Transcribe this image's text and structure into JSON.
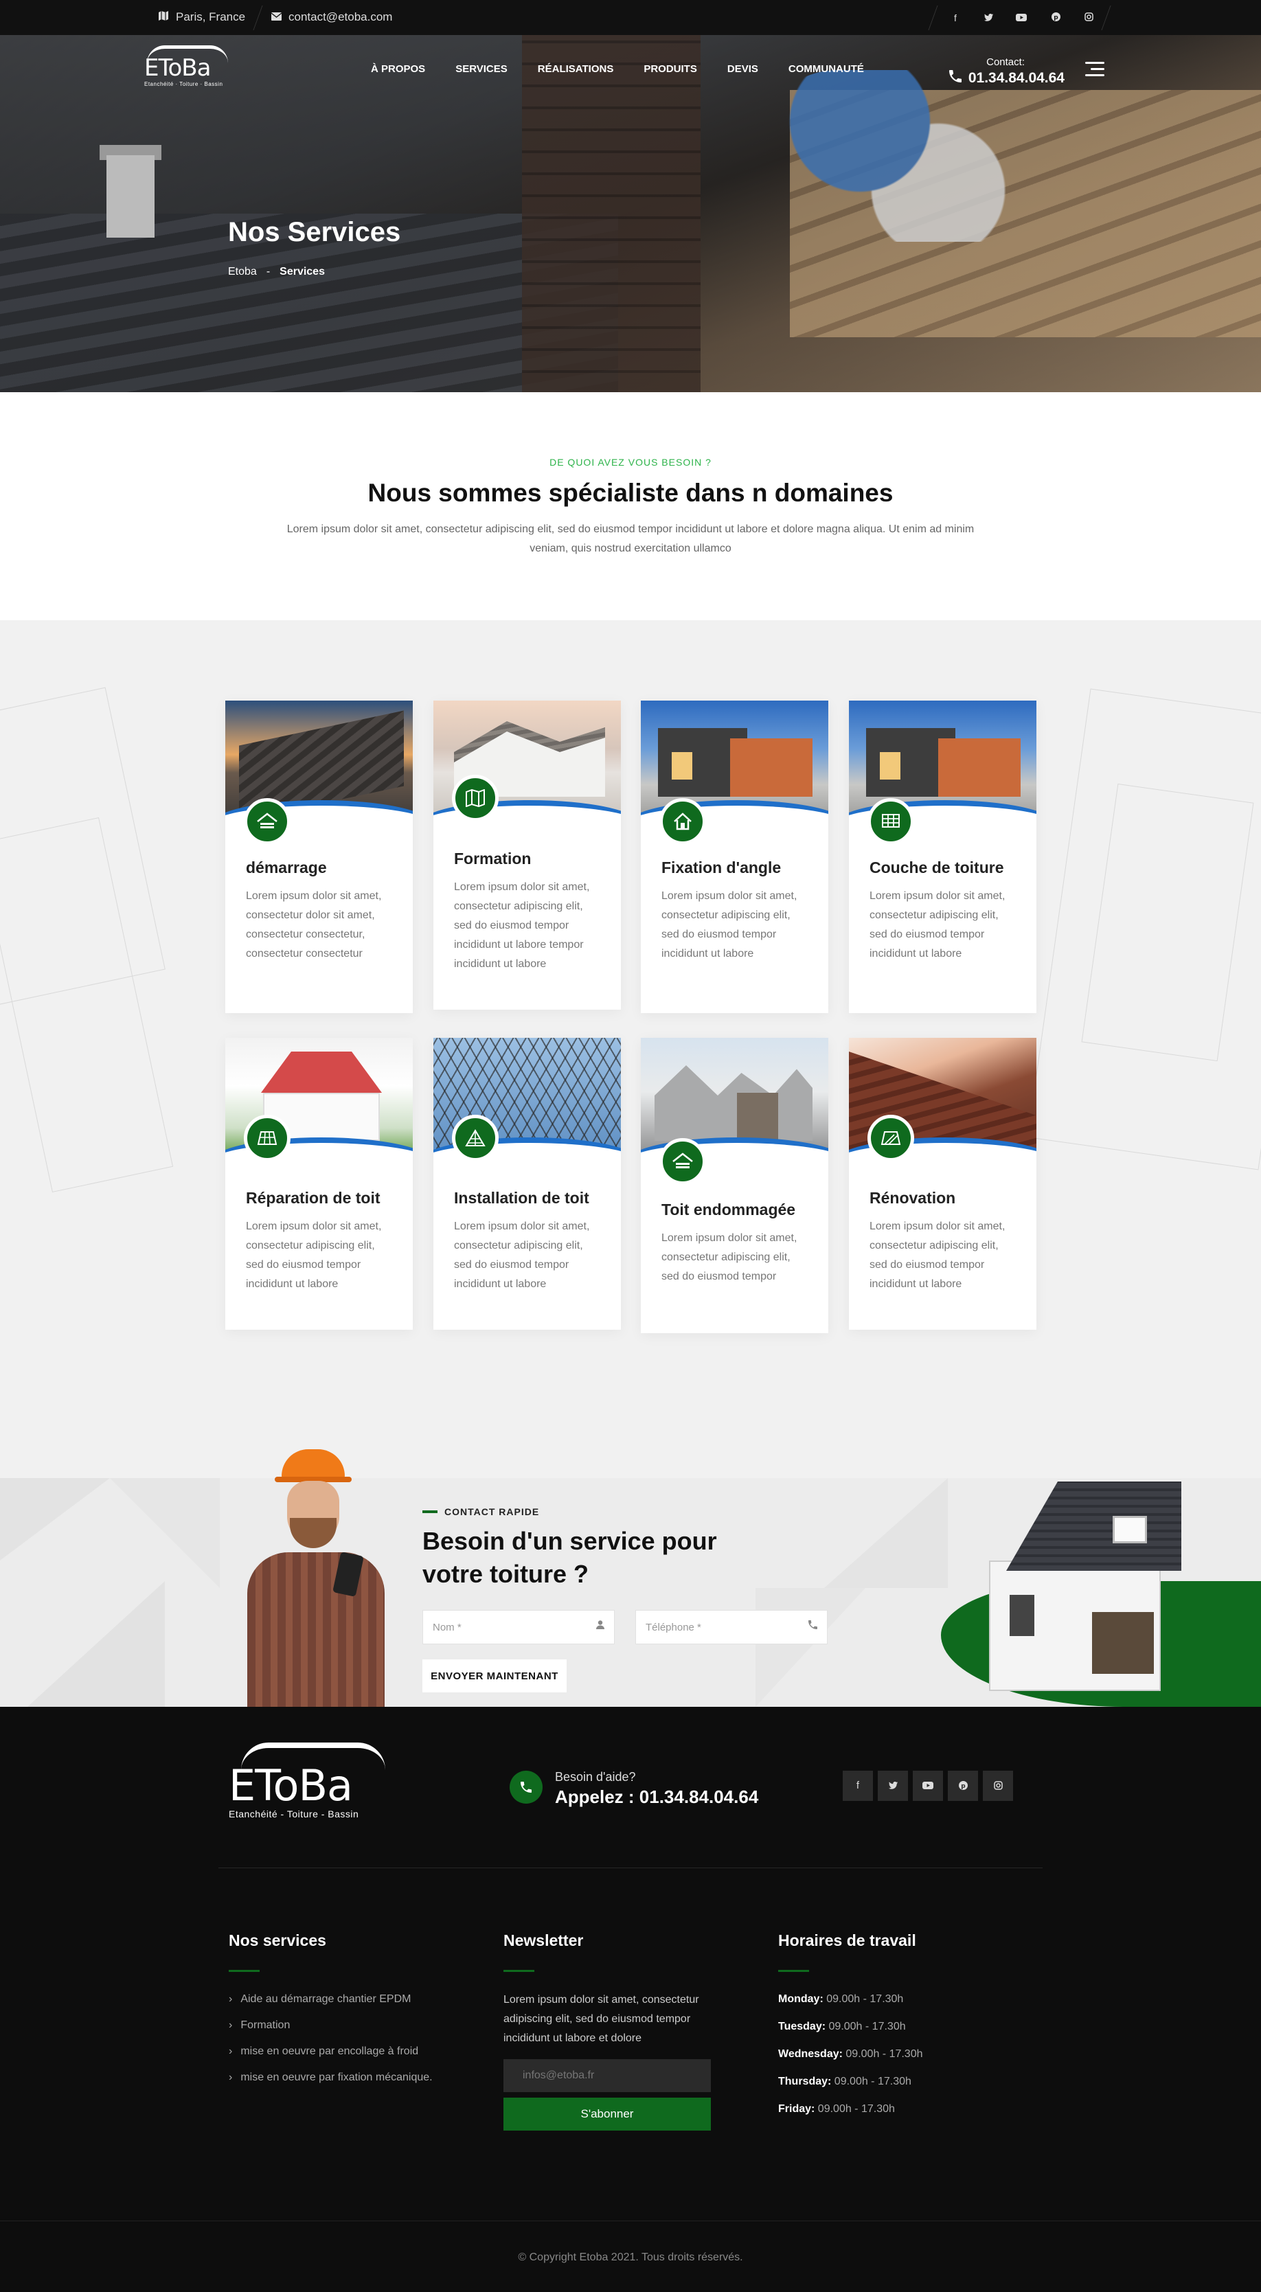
{
  "topbar": {
    "location": "Paris, France",
    "email": "contact@etoba.com",
    "social": [
      "facebook-icon",
      "twitter-icon",
      "youtube-icon",
      "pinterest-icon",
      "instagram-icon"
    ]
  },
  "header": {
    "logo_text": "EToBa",
    "logo_sub": "Etanchéité · Toiture · Bassin",
    "nav": [
      "À PROPOS",
      "SERVICES",
      "RÉALISATIONS",
      "PRODUITS",
      "DEVIS",
      "COMMUNAUTÉ"
    ],
    "contact_label": "Contact:",
    "contact_phone": "01.34.84.04.64"
  },
  "hero": {
    "title": "Nos Services",
    "breadcrumb_home": "Etoba",
    "breadcrumb_sep": "-",
    "breadcrumb_current": "Services"
  },
  "intro": {
    "kicker": "DE QUOI AVEZ VOUS BESOIN ?",
    "title": "Nous sommes spécialiste dans n domaines",
    "text": "Lorem ipsum dolor sit amet, consectetur adipiscing elit, sed do eiusmod tempor incididunt ut labore et dolore magna aliqua. Ut enim ad minim veniam, quis nostrud exercitation ullamco"
  },
  "services": [
    {
      "title": "démarrage",
      "text": "Lorem ipsum dolor sit amet, consectetur dolor sit amet, consectetur consectetur, consectetur consectetur",
      "icon": "roof-icon"
    },
    {
      "title": "Formation",
      "text": "Lorem ipsum dolor sit amet, consectetur adipiscing elit, sed do eiusmod tempor incididunt ut labore tempor incididunt ut labore",
      "icon": "map-icon"
    },
    {
      "title": "Fixation d'angle",
      "text": "Lorem ipsum dolor sit amet, consectetur adipiscing elit, sed do eiusmod tempor incididunt ut labore",
      "icon": "house-icon"
    },
    {
      "title": "Couche de toiture",
      "text": "Lorem ipsum dolor sit amet, consectetur adipiscing elit, sed do eiusmod tempor incididunt ut labore",
      "icon": "solar-panel-icon"
    },
    {
      "title": "Réparation de toit",
      "text": "Lorem ipsum dolor sit amet, consectetur adipiscing elit, sed do eiusmod tempor incididunt ut labore",
      "icon": "tiles-icon"
    },
    {
      "title": "Installation de toit",
      "text": "Lorem ipsum dolor sit amet, consectetur adipiscing elit, sed do eiusmod tempor incididunt ut labore",
      "icon": "frame-icon"
    },
    {
      "title": "Toit endommagée",
      "text": "Lorem ipsum dolor sit amet, consectetur adipiscing elit, sed do eiusmod tempor",
      "icon": "damaged-roof-icon"
    },
    {
      "title": "Rénovation",
      "text": "Lorem ipsum dolor sit amet, consectetur adipiscing elit, sed do eiusmod tempor incididunt ut labore",
      "icon": "renovation-icon"
    }
  ],
  "quick_contact": {
    "kicker": "CONTACT RAPIDE",
    "title": "Besoin d'un service pour votre toiture ?",
    "name_placeholder": "Nom *",
    "phone_placeholder": "Téléphone *",
    "submit": "ENVOYER MAINTENANT"
  },
  "footer": {
    "logo_text": "EToBa",
    "logo_sub": "Etanchéité - Toiture - Bassin",
    "help": "Besoin d'aide?",
    "call": "Appelez : 01.34.84.04.64",
    "social": [
      "facebook-icon",
      "twitter-icon",
      "youtube-icon",
      "pinterest-icon",
      "instagram-icon"
    ],
    "services_title": "Nos services",
    "services_links": [
      "Aide au démarrage chantier EPDM",
      "Formation",
      "mise en oeuvre par encollage à froid",
      "mise en oeuvre par fixation mécanique."
    ],
    "newsletter_title": "Newsletter",
    "newsletter_text": "Lorem ipsum dolor sit amet, consectetur adipiscing elit, sed do eiusmod tempor incididunt ut labore et dolore",
    "email_placeholder": "infos@etoba.fr",
    "subscribe": "S'abonner",
    "hours_title": "Horaires de travail",
    "hours": [
      {
        "day": "Monday:",
        "time": "09.00h - 17.30h"
      },
      {
        "day": "Tuesday:",
        "time": "09.00h - 17.30h"
      },
      {
        "day": "Wednesday:",
        "time": "09.00h - 17.30h"
      },
      {
        "day": "Thursday:",
        "time": "09.00h - 17.30h"
      },
      {
        "day": "Friday:",
        "time": "09.00h - 17.30h"
      }
    ],
    "copyright": "© Copyright Etoba 2021. Tous droits réservés."
  },
  "colors": {
    "accent": "#0f6a1e",
    "kicker_green": "#2db34a",
    "wave_blue": "#1f6fc9",
    "footer_bg": "#0d0d0d"
  }
}
